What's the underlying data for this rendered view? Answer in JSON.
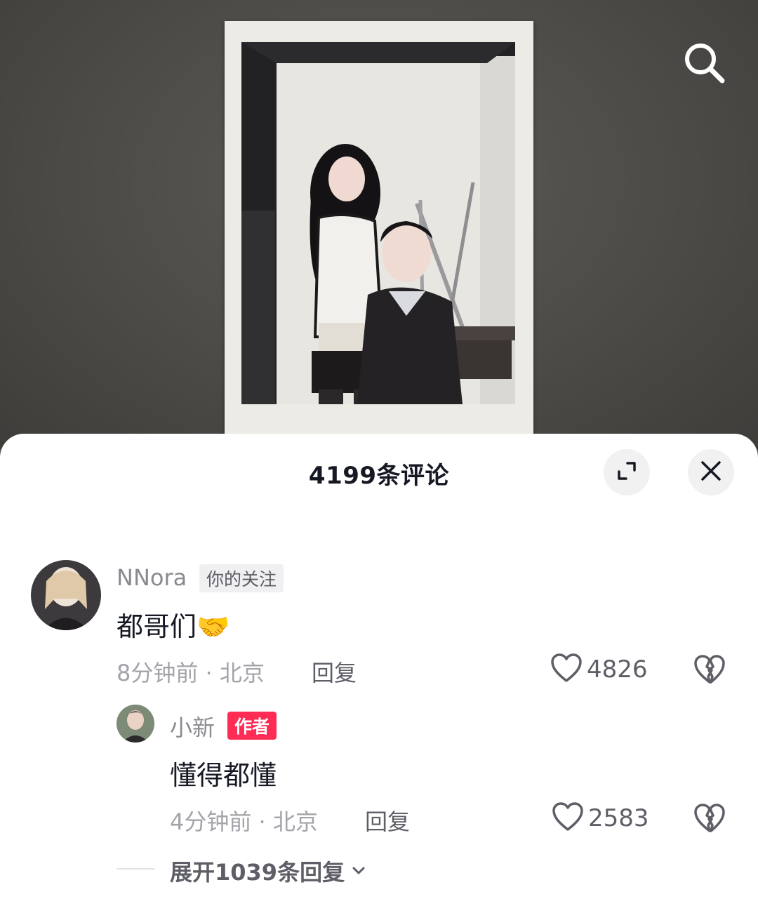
{
  "comments_panel": {
    "title": "4199条评论"
  },
  "comments": [
    {
      "username": "NNora",
      "tag": "你的关注",
      "text": "都哥们🤝",
      "meta": "8分钟前 · 北京",
      "reply_label": "回复",
      "likes": "4826"
    }
  ],
  "replies": [
    {
      "username": "小新",
      "tag": "作者",
      "text": "懂得都懂",
      "meta": "4分钟前 · 北京",
      "reply_label": "回复",
      "likes": "2583"
    }
  ],
  "expand_replies_label": "展开1039条回复",
  "icons": {
    "search": "search-icon",
    "expand": "expand-icon",
    "close": "close-icon",
    "like": "heart-outline-icon",
    "dislike": "broken-heart-icon",
    "chevron": "chevron-down-icon"
  },
  "colors": {
    "author_tag": "#fe2c55",
    "text_primary": "#161823",
    "text_secondary": "#a3a4aa"
  }
}
